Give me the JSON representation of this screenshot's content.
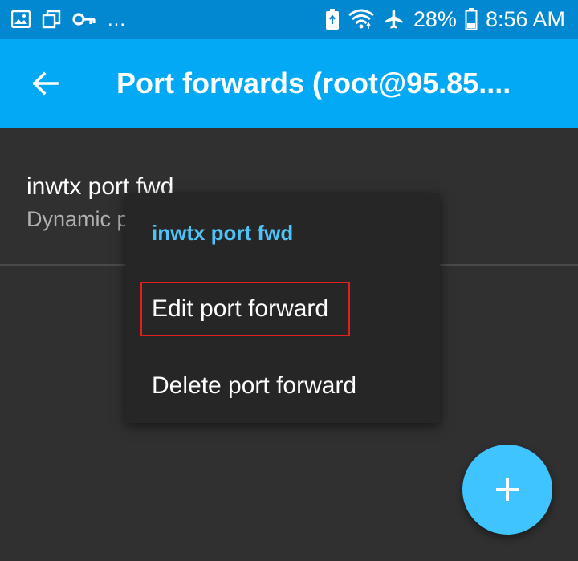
{
  "status_bar": {
    "left_icons": [
      "image-icon",
      "recents-icon",
      "key-icon"
    ],
    "overflow": "...",
    "right_icons": [
      "battery-saver-icon",
      "wifi-icon",
      "airplane-icon",
      "battery-icon"
    ],
    "battery_percent": "28%",
    "time": "8:56 AM"
  },
  "app_bar": {
    "title": "Port forwards (root@95.85....",
    "back_icon": "arrow-left-icon",
    "color": "#03A9F4"
  },
  "list": {
    "items": [
      {
        "title": "inwtx port fwd",
        "subtitle": "Dynamic p"
      }
    ]
  },
  "context_menu": {
    "title": "inwtx port fwd",
    "items": [
      {
        "label": "Edit port forward",
        "highlighted": true
      },
      {
        "label": "Delete port forward"
      }
    ]
  },
  "fab": {
    "icon": "plus-icon",
    "color": "#40C4FF"
  },
  "colors": {
    "background": "#303030",
    "status_bar": "#0288D1",
    "menu_title": "#4FC3F7",
    "highlight_border": "#E02020"
  }
}
